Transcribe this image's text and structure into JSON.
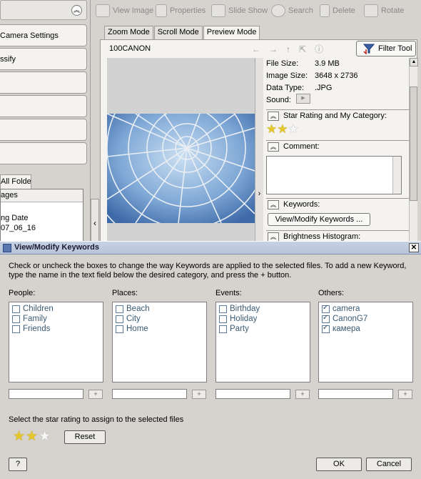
{
  "left_panel": {
    "items": [
      "Camera Settings",
      "ssify",
      "",
      "",
      "",
      "",
      ""
    ],
    "tab": "All Folders",
    "folder_header": "ages",
    "folder_lines": [
      "ng Date",
      "07_06_16"
    ]
  },
  "toolbar": {
    "buttons": [
      "View Image",
      "Properties",
      "Slide Show",
      "Search",
      "Delete",
      "Rotate"
    ]
  },
  "view_tabs": [
    "Zoom Mode",
    "Scroll Mode",
    "Preview Mode"
  ],
  "viewer": {
    "folder_name": "100CANON",
    "filter_button": "Filter Tool",
    "info": [
      {
        "label": "File Size:",
        "value": "3.9 MB"
      },
      {
        "label": "Image Size:",
        "value": "3648 x 2736"
      },
      {
        "label": "Data Type:",
        "value": ".JPG"
      },
      {
        "label": "Sound:",
        "value": ""
      }
    ],
    "star_section": "Star Rating and My Category:",
    "star_rating": 2,
    "comment_section": "Comment:",
    "keywords_section": "Keywords:",
    "keywords_button": "View/Modify Keywords ...",
    "histogram_section": "Brightness Histogram:"
  },
  "dialog": {
    "title": "View/Modify Keywords",
    "description": "Check or uncheck the boxes to change the way Keywords are applied to the selected files. To add a new Keyword, type the name in the text field below the desired category, and press the + button.",
    "columns": [
      {
        "label": "People:",
        "keywords": [
          {
            "name": "Children",
            "checked": false
          },
          {
            "name": "Family",
            "checked": false
          },
          {
            "name": "Friends",
            "checked": false
          }
        ],
        "input_value": ""
      },
      {
        "label": "Places:",
        "keywords": [
          {
            "name": "Beach",
            "checked": false
          },
          {
            "name": "City",
            "checked": false
          },
          {
            "name": "Home",
            "checked": false
          }
        ],
        "input_value": ""
      },
      {
        "label": "Events:",
        "keywords": [
          {
            "name": "Birthday",
            "checked": false
          },
          {
            "name": "Holiday",
            "checked": false
          },
          {
            "name": "Party",
            "checked": false
          }
        ],
        "input_value": ""
      },
      {
        "label": "Others:",
        "keywords": [
          {
            "name": "camera",
            "checked": true
          },
          {
            "name": "CanonG7",
            "checked": true
          },
          {
            "name": "камера",
            "checked": true
          }
        ],
        "input_value": ""
      }
    ],
    "plus_label": "+",
    "star_label": "Select the star rating to assign to the selected files",
    "star_rating": 2,
    "star_max": 3,
    "reset_button": "Reset",
    "help_button": "?",
    "ok_button": "OK",
    "cancel_button": "Cancel"
  }
}
